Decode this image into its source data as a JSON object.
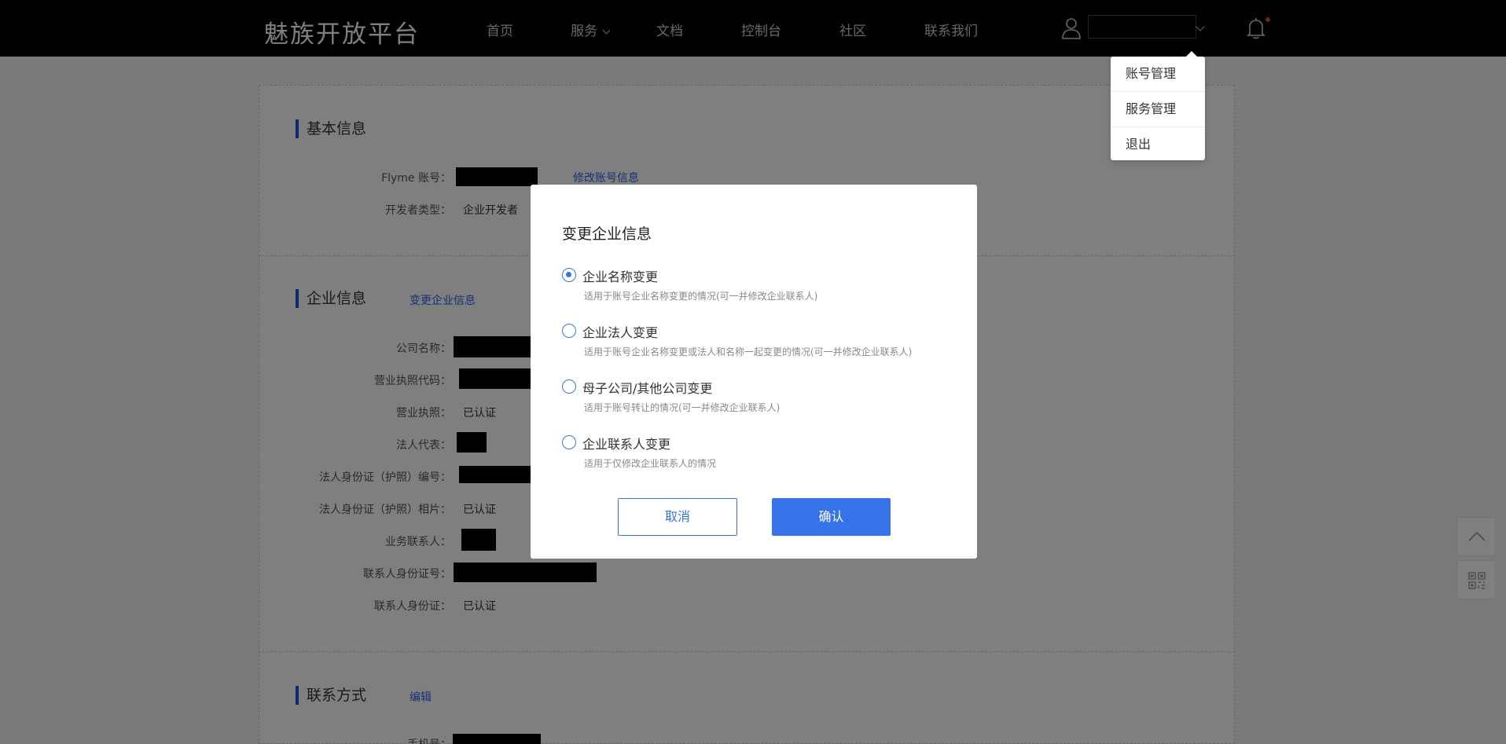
{
  "header": {
    "logo": "魅族开放平台",
    "nav": [
      {
        "label": "首页"
      },
      {
        "label": "服务"
      },
      {
        "label": "文档"
      },
      {
        "label": "控制台"
      },
      {
        "label": "社区"
      },
      {
        "label": "联系我们"
      }
    ],
    "icons": {
      "user": "user-icon",
      "dropdown": "chevron-down-icon",
      "bell": "bell-icon"
    }
  },
  "user_menu": {
    "items": [
      {
        "label": "账号管理"
      },
      {
        "label": "服务管理"
      },
      {
        "label": "退出"
      }
    ]
  },
  "basic_info": {
    "title": "基本信息",
    "account_label": "Flyme 账号：",
    "edit_link": "修改账号信息",
    "dev_type_label": "开发者类型：",
    "dev_type_value": "企业开发者"
  },
  "company_info": {
    "title": "企业信息",
    "change_link": "变更企业信息",
    "rows": [
      {
        "label": "公司名称：",
        "value": ""
      },
      {
        "label": "营业执照代码：",
        "value": ""
      },
      {
        "label": "营业执照：",
        "value": "已认证"
      },
      {
        "label": "法人代表：",
        "value": ""
      },
      {
        "label": "法人身份证（护照）编号：",
        "value": ""
      },
      {
        "label": "法人身份证（护照）相片：",
        "value": "已认证"
      },
      {
        "label": "业务联系人：",
        "value": ""
      },
      {
        "label": "联系人身份证号：",
        "value": ""
      },
      {
        "label": "联系人身份证：",
        "value": "已认证"
      }
    ]
  },
  "contact": {
    "title": "联系方式",
    "edit_link": "编辑",
    "phone_label": "手机号："
  },
  "side": {
    "icons": [
      "arrow-up-icon",
      "qrcode-icon"
    ]
  },
  "modal": {
    "title": "变更企业信息",
    "options": [
      {
        "label": "企业名称变更",
        "desc": "适用于账号企业名称变更的情况(可一并修改企业联系人)",
        "checked": true
      },
      {
        "label": "企业法人变更",
        "desc": "适用于账号企业名称变更或法人和名称一起变更的情况(可一并修改企业联系人)",
        "checked": false
      },
      {
        "label": "母子公司/其他公司变更",
        "desc": "适用于账号转让的情况(可一并修改企业联系人)",
        "checked": false
      },
      {
        "label": "企业联系人变更",
        "desc": "适用于仅修改企业联系人的情况",
        "checked": false
      }
    ],
    "cancel_label": "取消",
    "confirm_label": "确认"
  },
  "colors": {
    "accent": "#3673e8",
    "section_bar": "#1f55d6",
    "notification_dot": "#e0463a"
  }
}
